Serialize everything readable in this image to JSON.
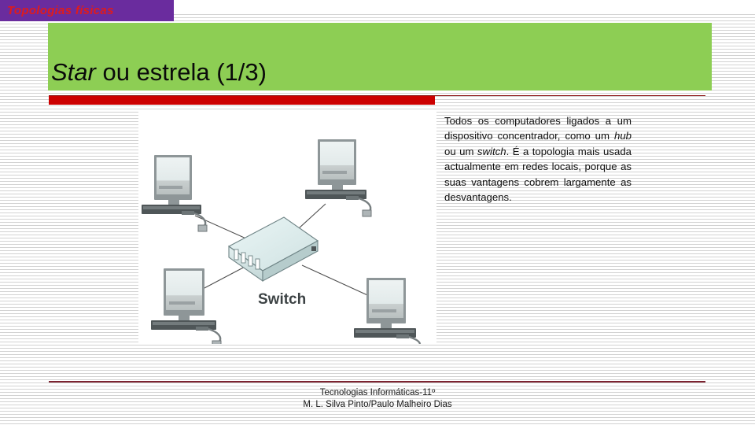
{
  "slide": {
    "topic_tab": "Topologias físicas",
    "heading": {
      "emphasis": "Star",
      "rest": " ou estrela (1/3)"
    },
    "body": {
      "part1": "Todos os computadores ligados a um dispositivo concentrador, como um ",
      "term1": "hub",
      "part2": " ou um ",
      "term2": "switch",
      "part3": ". É a topologia mais usada actualmente em redes locais, porque as suas vantagens cobrem largamente as desvantagens."
    },
    "diagram": {
      "caption": "Switch",
      "alt": "Diagrama de topologia em estrela: quatro computadores ligados a um switch central",
      "nodes": [
        {
          "id": "pc-top-left",
          "label": ""
        },
        {
          "id": "pc-top-right",
          "label": ""
        },
        {
          "id": "pc-bottom-left",
          "label": ""
        },
        {
          "id": "pc-bottom-right",
          "label": ""
        },
        {
          "id": "switch-center",
          "label": "Switch"
        }
      ]
    },
    "footer": {
      "line1": "Tecnologias Informáticas-11º",
      "line2": "M. L. Silva Pinto/Paulo Malheiro Dias"
    },
    "colors": {
      "tab_background": "#6A2C9E",
      "tab_text": "#E01B1B",
      "band_green": "#8DCE54",
      "bar_red": "#CC0000",
      "footer_rule": "#7C2330",
      "hairline": "#D2D2D2"
    }
  }
}
